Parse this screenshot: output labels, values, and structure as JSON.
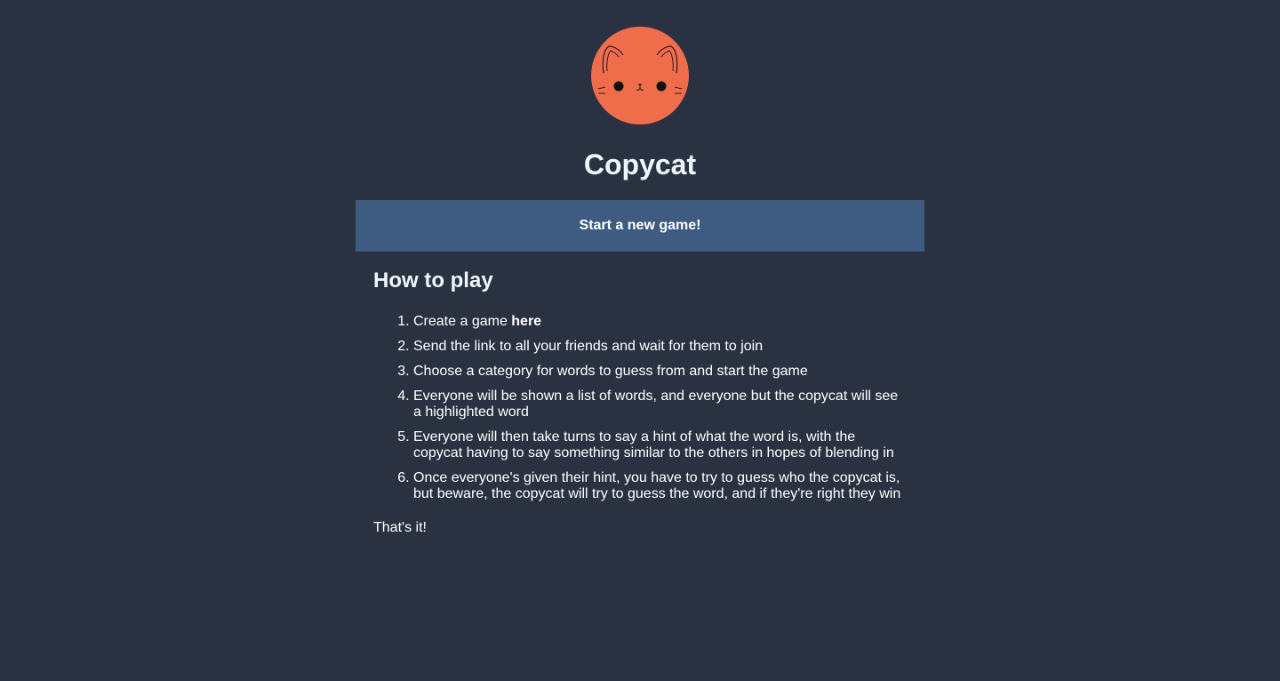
{
  "app": {
    "title": "Copycat",
    "logo_icon": "cat-face-icon",
    "logo_color": "#f06d4c"
  },
  "actions": {
    "start_label": "Start a new game!",
    "button_color": "#3e5b81"
  },
  "how_to_play": {
    "heading": "How to play",
    "steps": [
      {
        "prefix": "Create a game ",
        "link": "here"
      },
      {
        "text": "Send the link to all your friends and wait for them to join"
      },
      {
        "text": "Choose a category for words to guess from and start the game"
      },
      {
        "text": "Everyone will be shown a list of words, and everyone but the copycat will see a highlighted word"
      },
      {
        "text": "Everyone will then take turns to say a hint of what the word is, with the copycat having to say something similar to the others in hopes of blending in"
      },
      {
        "text": "Once everyone's given their hint, you have to try to guess who the copycat is, but beware, the copycat will try to guess the word, and if they're right they win"
      }
    ],
    "outro": "That's it!"
  },
  "colors": {
    "background": "#2a3241",
    "text": "#ffffff"
  }
}
